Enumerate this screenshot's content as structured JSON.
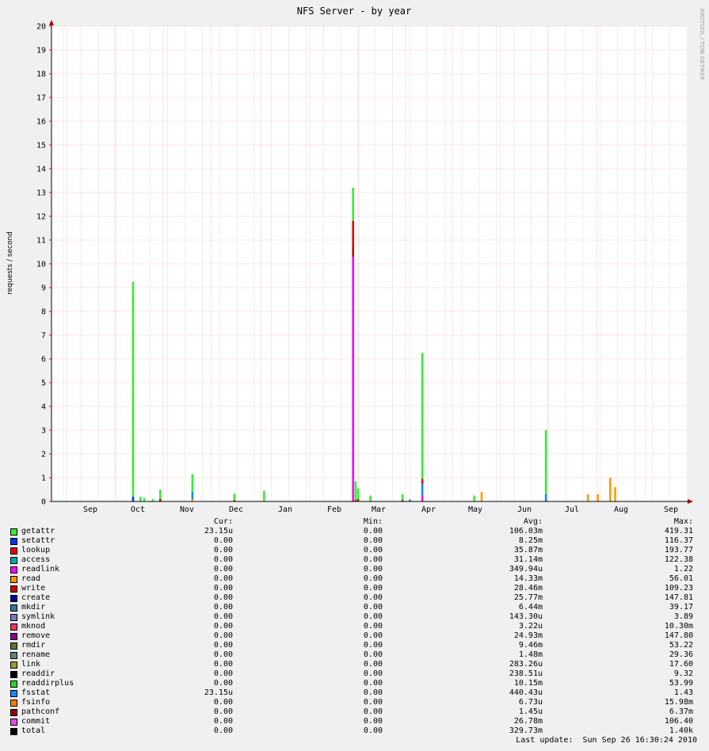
{
  "chart_data": {
    "type": "area",
    "title": "NFS Server - by year",
    "ylabel": "requests / second",
    "xlabel": "",
    "ylim": [
      0,
      20
    ],
    "y_ticks": [
      "0",
      "1",
      "2",
      "3",
      "4",
      "5",
      "6",
      "7",
      "8",
      "9",
      "10",
      "11",
      "12",
      "13",
      "14",
      "15",
      "16",
      "17",
      "18",
      "19",
      "20"
    ],
    "x_months": [
      "Sep",
      "Oct",
      "Nov",
      "Dec",
      "Jan",
      "Feb",
      "Mar",
      "Apr",
      "May",
      "Jun",
      "Jul",
      "Aug",
      "Sep"
    ],
    "grid": true,
    "watermark": "RRDTOOL / TOBI OETIKER",
    "spikes": [
      {
        "x_day": 33.0,
        "layers": [
          [
            "setattr",
            0.2
          ],
          [
            "getattr",
            9.05
          ]
        ]
      },
      {
        "x_day": 36.0,
        "layers": [
          [
            "getattr",
            0.2
          ]
        ]
      },
      {
        "x_day": 37.5,
        "layers": [
          [
            "getattr",
            0.15
          ]
        ]
      },
      {
        "x_day": 41.0,
        "layers": [
          [
            "getattr",
            0.1
          ]
        ]
      },
      {
        "x_day": 44.0,
        "layers": [
          [
            "write",
            0.1
          ],
          [
            "getattr",
            0.4
          ]
        ]
      },
      {
        "x_day": 57.0,
        "layers": [
          [
            "read",
            0.1
          ],
          [
            "fsstat",
            0.3
          ],
          [
            "getattr",
            0.75
          ]
        ]
      },
      {
        "x_day": 74.0,
        "layers": [
          [
            "write",
            0.05
          ],
          [
            "getattr",
            0.28
          ]
        ]
      },
      {
        "x_day": 86.0,
        "layers": [
          [
            "getattr",
            0.45
          ]
        ]
      },
      {
        "x_day": 122.0,
        "layers": [
          [
            "readlink",
            10.3
          ],
          [
            "write",
            0.4
          ],
          [
            "lookup",
            1.1
          ],
          [
            "getattr",
            1.4
          ]
        ]
      },
      {
        "x_day": 123.0,
        "layers": [
          [
            "write",
            0.05
          ],
          [
            "getattr",
            0.8
          ]
        ]
      },
      {
        "x_day": 124.0,
        "layers": [
          [
            "write",
            0.1
          ],
          [
            "getattr",
            0.45
          ]
        ]
      },
      {
        "x_day": 129.0,
        "layers": [
          [
            "getattr",
            0.25
          ]
        ]
      },
      {
        "x_day": 142.0,
        "layers": [
          [
            "write",
            0.05
          ],
          [
            "getattr",
            0.25
          ]
        ]
      },
      {
        "x_day": 145.0,
        "layers": [
          [
            "fsstat",
            0.08
          ]
        ]
      },
      {
        "x_day": 150.0,
        "layers": [
          [
            "readlink",
            0.25
          ],
          [
            "fsstat",
            0.5
          ],
          [
            "lookup",
            0.2
          ],
          [
            "getattr",
            5.3
          ]
        ]
      },
      {
        "x_day": 171.0,
        "layers": [
          [
            "getattr",
            0.25
          ]
        ]
      },
      {
        "x_day": 174.0,
        "layers": [
          [
            "read",
            0.4
          ]
        ]
      },
      {
        "x_day": 200.0,
        "layers": [
          [
            "fsstat",
            0.3
          ],
          [
            "getattr",
            2.7
          ]
        ]
      },
      {
        "x_day": 217.0,
        "layers": [
          [
            "read",
            0.3
          ]
        ]
      },
      {
        "x_day": 221.0,
        "layers": [
          [
            "read",
            0.3
          ]
        ]
      },
      {
        "x_day": 226.0,
        "layers": [
          [
            "read",
            1.0
          ]
        ]
      },
      {
        "x_day": 228.0,
        "layers": [
          [
            "read",
            0.6
          ]
        ]
      }
    ]
  },
  "legend": {
    "headers": {
      "cur": "Cur:",
      "min": "Min:",
      "avg": "Avg:",
      "max": "Max:"
    },
    "rows": [
      {
        "name": "getattr",
        "color": "#33ee33",
        "cur": "23.15u",
        "min": "0.00",
        "avg": "106.03m",
        "max": "419.31"
      },
      {
        "name": "setattr",
        "color": "#0033ff",
        "cur": "0.00",
        "min": "0.00",
        "avg": "8.25m",
        "max": "116.37"
      },
      {
        "name": "lookup",
        "color": "#ee0000",
        "cur": "0.00",
        "min": "0.00",
        "avg": "35.87m",
        "max": "193.77"
      },
      {
        "name": "access",
        "color": "#00aaaa",
        "cur": "0.00",
        "min": "0.00",
        "avg": "31.14m",
        "max": "122.38"
      },
      {
        "name": "readlink",
        "color": "#ff00ff",
        "cur": "0.00",
        "min": "0.00",
        "avg": "349.94u",
        "max": "1.22"
      },
      {
        "name": "read",
        "color": "#ff9900",
        "cur": "0.00",
        "min": "0.00",
        "avg": "14.33m",
        "max": "56.01"
      },
      {
        "name": "write",
        "color": "#cc0000",
        "cur": "0.00",
        "min": "0.00",
        "avg": "28.46m",
        "max": "109.23"
      },
      {
        "name": "create",
        "color": "#0000aa",
        "cur": "0.00",
        "min": "0.00",
        "avg": "25.77m",
        "max": "147.81"
      },
      {
        "name": "mkdir",
        "color": "#337799",
        "cur": "0.00",
        "min": "0.00",
        "avg": "6.44m",
        "max": "39.17"
      },
      {
        "name": "symlink",
        "color": "#7777cc",
        "cur": "0.00",
        "min": "0.00",
        "avg": "143.30u",
        "max": "3.89"
      },
      {
        "name": "mknod",
        "color": "#ee3366",
        "cur": "0.00",
        "min": "0.00",
        "avg": "3.22u",
        "max": "10.30m"
      },
      {
        "name": "remove",
        "color": "#880099",
        "cur": "0.00",
        "min": "0.00",
        "avg": "24.93m",
        "max": "147.80"
      },
      {
        "name": "rmdir",
        "color": "#557733",
        "cur": "0.00",
        "min": "0.00",
        "avg": "9.46m",
        "max": "53.22"
      },
      {
        "name": "rename",
        "color": "#558877",
        "cur": "0.00",
        "min": "0.00",
        "avg": "1.48m",
        "max": "29.36"
      },
      {
        "name": "link",
        "color": "#999933",
        "cur": "0.00",
        "min": "0.00",
        "avg": "283.26u",
        "max": "17.60"
      },
      {
        "name": "readdir",
        "color": "#000000",
        "cur": "0.00",
        "min": "0.00",
        "avg": "238.51u",
        "max": "9.32"
      },
      {
        "name": "readdirplus",
        "color": "#22dd22",
        "cur": "0.00",
        "min": "0.00",
        "avg": "10.15m",
        "max": "53.99"
      },
      {
        "name": "fsstat",
        "color": "#1188ff",
        "cur": "23.15u",
        "min": "0.00",
        "avg": "440.43u",
        "max": "1.43"
      },
      {
        "name": "fsinfo",
        "color": "#ff7700",
        "cur": "0.00",
        "min": "0.00",
        "avg": "6.73u",
        "max": "15.98m"
      },
      {
        "name": "pathconf",
        "color": "#990000",
        "cur": "0.00",
        "min": "0.00",
        "avg": "1.45u",
        "max": "6.37m"
      },
      {
        "name": "commit",
        "color": "#ee44ee",
        "cur": "0.00",
        "min": "0.00",
        "avg": "26.78m",
        "max": "106.40"
      },
      {
        "name": "total",
        "color": "#000000",
        "cur": "0.00",
        "min": "0.00",
        "avg": "329.73m",
        "max": "1.40k"
      }
    ]
  },
  "last_update": "Last update:  Sun Sep 26 16:30:24 2010"
}
